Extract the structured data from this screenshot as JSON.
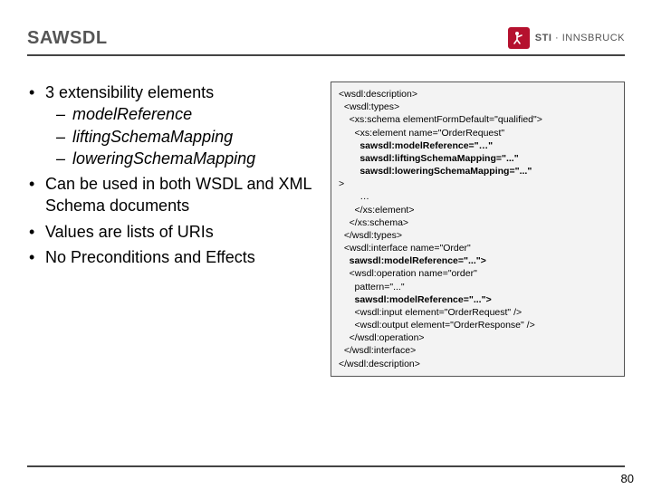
{
  "header": {
    "title": "SAWSDL",
    "logo_org": "STI",
    "logo_sep": "·",
    "logo_place": "INNSBRUCK"
  },
  "bullets": {
    "b1": "3 extensibility elements",
    "b1_sub": [
      "modelReference",
      "liftingSchemaMapping",
      "loweringSchemaMapping"
    ],
    "b2": "Can be used in both WSDL and XML Schema documents",
    "b3": "Values are lists of URIs",
    "b4": "No Preconditions and Effects"
  },
  "code": {
    "l01": "<wsdl:description>",
    "l02": "  <wsdl:types>",
    "l03": "    <xs:schema elementFormDefault=\"qualified\">",
    "l04": "      <xs:element name=\"OrderRequest\"",
    "l05": "        sawsdl:modelReference=\"…\"",
    "l06": "        sawsdl:liftingSchemaMapping=\"...\"",
    "l07": "        sawsdl:loweringSchemaMapping=\"...\"",
    "l08": ">",
    "l09": "        …",
    "l10": "      </xs:element>",
    "l11": "    </xs:schema>",
    "l12": "  </wsdl:types>",
    "l13": "  <wsdl:interface name=\"Order\"",
    "l14": "    sawsdl:modelReference=\"...\">",
    "l15": "    <wsdl:operation name=\"order\"",
    "l16": "      pattern=\"...\"",
    "l17": "      sawsdl:modelReference=\"...\">",
    "l18": "      <wsdl:input element=\"OrderRequest\" />",
    "l19": "      <wsdl:output element=\"OrderResponse\" />",
    "l20": "    </wsdl:operation>",
    "l21": "  </wsdl:interface>",
    "l22": "</wsdl:description>"
  },
  "page": "80"
}
